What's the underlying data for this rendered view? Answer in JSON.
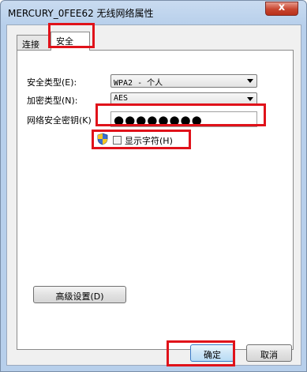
{
  "window": {
    "title": "MERCURY_0FEE62 无线网络属性",
    "close_glyph": "x"
  },
  "tabs": [
    {
      "label": "连接"
    },
    {
      "label": "安全"
    }
  ],
  "security": {
    "security_type_label": "安全类型(E):",
    "security_type_value": "WPA2 - 个人",
    "encryption_type_label": "加密类型(N):",
    "encryption_type_value": "AES",
    "key_label": "网络安全密钥(K)",
    "key_value": "●●●●●●●●",
    "show_chars_label": "显示字符(H)",
    "advanced_button": "高级设置(D)"
  },
  "buttons": {
    "ok": "确定",
    "cancel": "取消"
  },
  "colors": {
    "highlight": "#e0121a",
    "title_bar": "#b7cfeb"
  }
}
